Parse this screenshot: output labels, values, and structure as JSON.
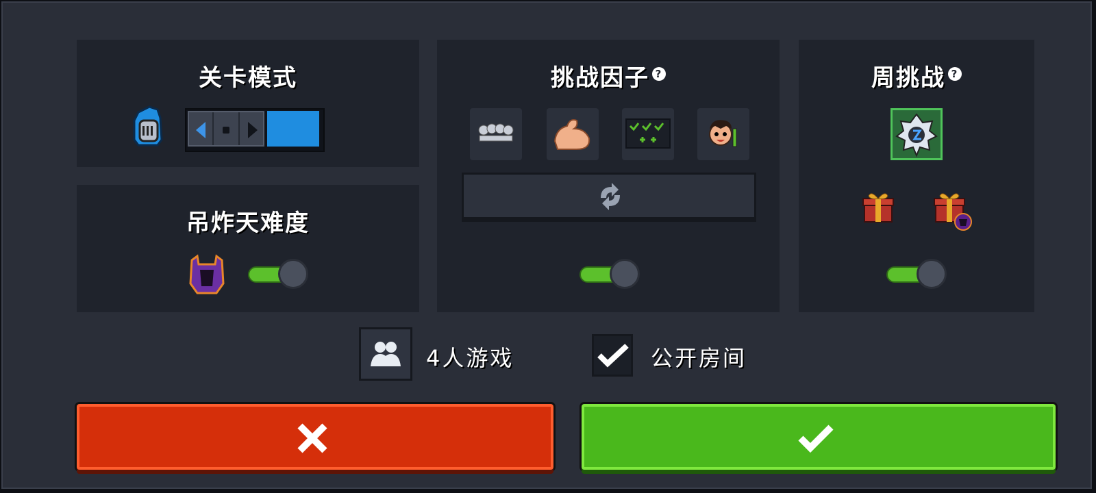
{
  "level_mode": {
    "title": "关卡模式",
    "icon": "knight-helmet-icon",
    "selector": {
      "left_icon": "arrow-left-icon",
      "middle_icon": "dot-icon",
      "right_icon": "arrow-right-icon",
      "accent": "#1f8de0"
    }
  },
  "difficulty": {
    "title": "吊炸天难度",
    "icon": "demon-helmet-icon",
    "toggle_on": true
  },
  "challenge_factors": {
    "title": "挑战因子",
    "help": "?",
    "factors": [
      "skull-crowd-icon",
      "muscle-arm-icon",
      "checkmarks-plus-icon",
      "crazy-face-icon"
    ],
    "refresh_icon": "refresh-icon",
    "toggle_on": true
  },
  "weekly_challenge": {
    "title": "周挑战",
    "help": "?",
    "badge_icon": "weekly-emblem-icon",
    "rewards": [
      "gift-icon",
      "gift-demon-icon"
    ],
    "toggle_on": true
  },
  "players": {
    "icon": "players-icon",
    "label": "4人游戏"
  },
  "public_room": {
    "checked": true,
    "label": "公开房间"
  },
  "actions": {
    "cancel_icon": "close-icon",
    "confirm_icon": "check-icon"
  },
  "colors": {
    "cancel": "#d52f0a",
    "confirm": "#4ab81c",
    "toggle_track": "#5cc02c"
  }
}
